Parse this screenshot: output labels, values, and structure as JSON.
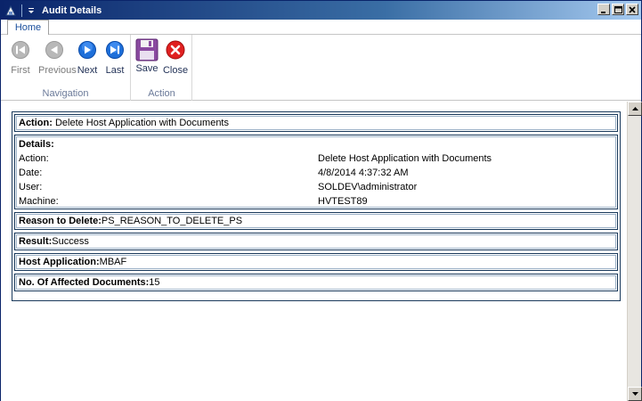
{
  "window": {
    "title": "Audit Details"
  },
  "ribbon": {
    "tabs": [
      {
        "label": "Home"
      }
    ],
    "navigation": {
      "label": "Navigation",
      "first": "First",
      "previous": "Previous",
      "next": "Next",
      "last": "Last"
    },
    "action": {
      "label": "Action",
      "save": "Save",
      "close": "Close"
    }
  },
  "audit": {
    "action": {
      "label": "Action:",
      "value": " Delete Host Application with Documents"
    },
    "details": {
      "label": "Details:",
      "rows": [
        {
          "key": "Action:",
          "value": "Delete Host Application with Documents"
        },
        {
          "key": "Date:",
          "value": "4/8/2014 4:37:32 AM"
        },
        {
          "key": "User:",
          "value": "SOLDEV\\administrator"
        },
        {
          "key": "Machine:",
          "value": "HVTEST89"
        }
      ]
    },
    "reason": {
      "label": "Reason to Delete:",
      "value": "PS_REASON_TO_DELETE_PS"
    },
    "result": {
      "label": "Result:",
      "value": "Success"
    },
    "host_application": {
      "label": "Host Application:",
      "value": "MBAF"
    },
    "affected_documents": {
      "label": "No. Of Affected Documents:",
      "value": "15"
    }
  },
  "colors": {
    "titlebar": "#0a246a",
    "accent": "#1b4f9c",
    "close_red": "#e02020",
    "save_purple": "#8a4aa0",
    "border_dark": "#1a3a5c"
  },
  "icons": {
    "app": "app-icon",
    "first": "skip-back-icon",
    "previous": "arrow-left-icon",
    "next": "arrow-right-icon",
    "last": "skip-forward-icon",
    "save": "floppy-disk-icon",
    "close": "close-circle-icon"
  }
}
